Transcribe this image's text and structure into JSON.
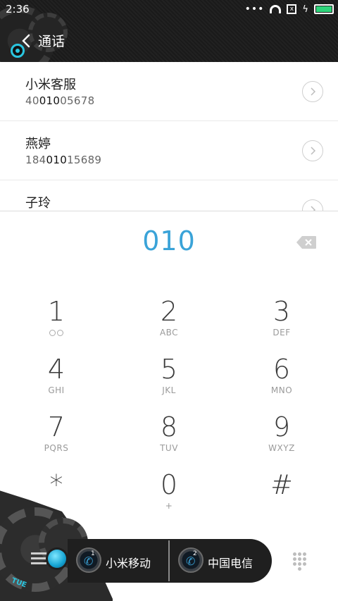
{
  "status_bar": {
    "time": "2:36",
    "dots": "•••",
    "sim_x": "x",
    "bolt": "ϟ"
  },
  "header": {
    "title": "通话"
  },
  "contacts": [
    {
      "name": "小米客服",
      "number_pre": "40",
      "number_match": "010",
      "number_post": "05678"
    },
    {
      "name": "燕婷",
      "number_pre": "184",
      "number_match": "010",
      "number_post": "15689"
    },
    {
      "name": "子玲",
      "number_pre": "",
      "number_match": "",
      "number_post": ""
    }
  ],
  "dial_input": {
    "value": "010"
  },
  "keypad": [
    {
      "num": "1",
      "sub": ""
    },
    {
      "num": "2",
      "sub": "ABC"
    },
    {
      "num": "3",
      "sub": "DEF"
    },
    {
      "num": "4",
      "sub": "GHI"
    },
    {
      "num": "5",
      "sub": "JKL"
    },
    {
      "num": "6",
      "sub": "MNO"
    },
    {
      "num": "7",
      "sub": "PQRS"
    },
    {
      "num": "8",
      "sub": "TUV"
    },
    {
      "num": "9",
      "sub": "WXYZ"
    },
    {
      "num": "*",
      "sub": ""
    },
    {
      "num": "0",
      "sub": "+"
    },
    {
      "num": "#",
      "sub": ""
    }
  ],
  "bottom_bar": {
    "sim1_index": "1",
    "sim1_label": "小米移动",
    "sim2_index": "2",
    "sim2_label": "中国电信",
    "theme_tag": "TUE"
  },
  "colors": {
    "accent": "#3aa3d8",
    "header_bg": "#1b1b1b",
    "theme_cyan": "#2ac6e0",
    "battery": "#2ed47a"
  }
}
